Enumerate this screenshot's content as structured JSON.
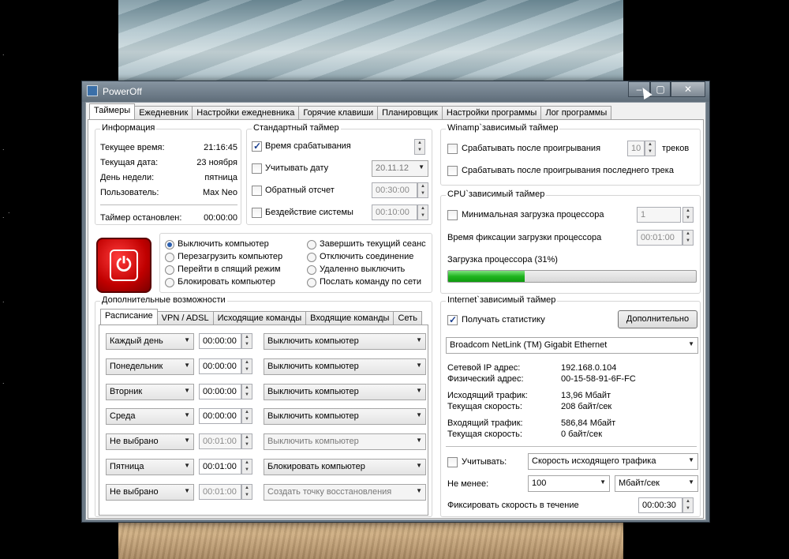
{
  "desktop": {
    "dots": [
      ".",
      ".",
      ".",
      ".",
      ".",
      "."
    ]
  },
  "window": {
    "title": "PowerOff",
    "min": "–",
    "max": "▢",
    "close": "✕"
  },
  "main_tabs": [
    "Таймеры",
    "Ежедневник",
    "Настройки ежедневника",
    "Горячие клавиши",
    "Планировщик",
    "Настройки программы",
    "Лог программы"
  ],
  "info": {
    "title": "Информация",
    "rows": [
      {
        "label": "Текущее время:",
        "value": "21:16:45"
      },
      {
        "label": "Текущая дата:",
        "value": "23 ноября"
      },
      {
        "label": "День недели:",
        "value": "пятница"
      },
      {
        "label": "Пользователь:",
        "value": "Max Neo"
      }
    ],
    "timer_label": "Таймер остановлен:",
    "timer_value": "00:00:00"
  },
  "std_timer": {
    "title": "Стандартный таймер",
    "rows": [
      {
        "label": "Время срабатывания",
        "value": ""
      },
      {
        "label": "Учитывать дату",
        "value": "20.11.12"
      },
      {
        "label": "Обратный отсчет",
        "value": "00:30:00"
      },
      {
        "label": "Бездействие системы",
        "value": "00:10:00"
      }
    ]
  },
  "actions": {
    "left": [
      "Выключить компьютер",
      "Перезагрузить компьютер",
      "Перейти в спящий режим",
      "Блокировать компьютер"
    ],
    "right": [
      "Завершить текущий сеанс",
      "Отключить соединение",
      "Удаленно выключить",
      "Послать команду по сети"
    ]
  },
  "extra": {
    "title": "Дополнительные возможности",
    "tabs": [
      "Расписание",
      "VPN / ADSL",
      "Исходящие команды",
      "Входящие команды",
      "Сеть"
    ],
    "schedule": [
      {
        "day": "Каждый день",
        "time": "00:00:00",
        "action": "Выключить компьютер"
      },
      {
        "day": "Понедельник",
        "time": "00:00:00",
        "action": "Выключить компьютер"
      },
      {
        "day": "Вторник",
        "time": "00:00:00",
        "action": "Выключить компьютер"
      },
      {
        "day": "Среда",
        "time": "00:00:00",
        "action": "Выключить компьютер"
      },
      {
        "day": "Не выбрано",
        "time": "00:01:00",
        "action": "Выключить компьютер"
      },
      {
        "day": "Пятница",
        "time": "00:01:00",
        "action": "Блокировать компьютер"
      },
      {
        "day": "Не выбрано",
        "time": "00:01:00",
        "action": "Создать точку восстановления"
      }
    ]
  },
  "winamp": {
    "title": "Winamp`зависимый таймер",
    "after_play": "Срабатывать после проигрывания",
    "tracks_value": "10",
    "tracks_label": "треков",
    "after_last": "Срабатывать после проигрывания последнего трека"
  },
  "cpu": {
    "title": "CPU`зависимый таймер",
    "min_load": "Минимальная загрузка процессора",
    "min_load_value": "1",
    "fix_time": "Время фиксации загрузки процессора",
    "fix_time_value": "00:01:00",
    "load_label": "Загрузка процессора (31%)",
    "load_percent": 31
  },
  "internet": {
    "title": "Internet`зависимый таймер",
    "get_stats": "Получать статистику",
    "more_button": "Дополнительно",
    "adapter": "Broadcom NetLink (TM) Gigabit Ethernet",
    "stats": [
      {
        "label": "Сетевой IP адрес:",
        "value": "192.168.0.104"
      },
      {
        "label": "Физический адрес:",
        "value": "00-15-58-91-6F-FC"
      },
      {
        "label": "Исходящий трафик:",
        "value": "13,96 Мбайт"
      },
      {
        "label": "Текущая скорость:",
        "value": "208 байт/сек"
      },
      {
        "label": "Входящий трафик:",
        "value": "586,84 Мбайт"
      },
      {
        "label": "Текущая скорость:",
        "value": "0 байт/сек"
      }
    ],
    "consider": "Учитывать:",
    "consider_value": "Скорость исходящего трафика",
    "not_less": "Не менее:",
    "not_less_value": "100",
    "unit": "Мбайт/сек",
    "fix_speed": "Фиксировать скорость в течение",
    "fix_speed_value": "00:00:30"
  }
}
